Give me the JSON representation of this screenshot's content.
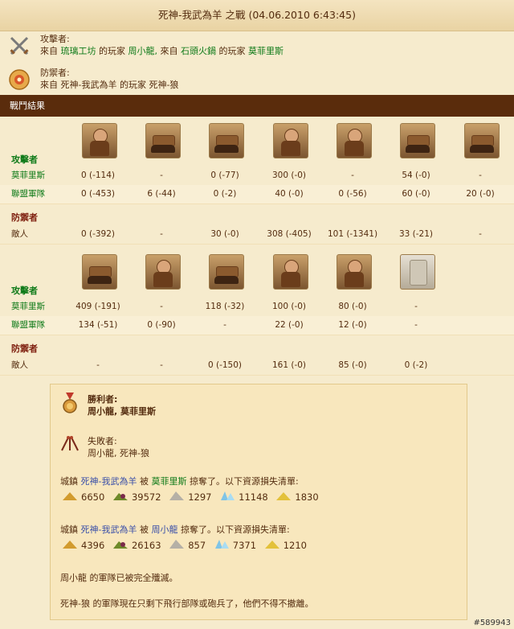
{
  "title": "死神-我武為羊 之戰 (04.06.2010 6:43:45)",
  "attacker": {
    "label": "攻擊者:",
    "from1_pre": "來自",
    "from1_town": "琉璃工坊",
    "from1_mid": "的玩家",
    "from1_player": "周小龍,",
    "from2_pre": "來自",
    "from2_town": "石頭火鍋",
    "from2_mid": "的玩家",
    "from2_player": "莫菲里斯"
  },
  "defender": {
    "label": "防禦者:",
    "text": "來自 死神-我武為羊 的玩家 死神-狼"
  },
  "section_title": "戰鬥結果",
  "battle1": {
    "attackers_label": "攻擊者",
    "defenders_label": "防禦者",
    "rows": [
      {
        "label": "莫菲里斯",
        "cells": [
          "0 (-114)",
          "-",
          "0 (-77)",
          "300 (-0)",
          "-",
          "54 (-0)",
          "-"
        ]
      },
      {
        "label": "聯盟軍隊",
        "cells": [
          "0 (-453)",
          "6 (-44)",
          "0 (-2)",
          "40 (-0)",
          "0 (-56)",
          "60 (-0)",
          "20 (-0)"
        ]
      }
    ],
    "enemy": {
      "label": "敵人",
      "cells": [
        "0 (-392)",
        "-",
        "30 (-0)",
        "308 (-405)",
        "101 (-1341)",
        "33 (-21)",
        "-"
      ]
    }
  },
  "battle2": {
    "attackers_label": "攻擊者",
    "defenders_label": "防禦者",
    "rows": [
      {
        "label": "莫菲里斯",
        "cells": [
          "409 (-191)",
          "-",
          "118 (-32)",
          "100 (-0)",
          "80 (-0)",
          "-"
        ]
      },
      {
        "label": "聯盟軍隊",
        "cells": [
          "134 (-51)",
          "0 (-90)",
          "-",
          "22 (-0)",
          "12 (-0)",
          "-"
        ]
      }
    ],
    "enemy": {
      "label": "敵人",
      "cells": [
        "-",
        "-",
        "0 (-150)",
        "161 (-0)",
        "85 (-0)",
        "0 (-2)"
      ]
    }
  },
  "summary": {
    "winner_label": "勝利者:",
    "winner_names": "周小龍, 莫菲里斯",
    "loser_label": "失敗者:",
    "loser_names": "周小龍, 死神-狼",
    "loot1": {
      "pre": "城鎮",
      "town": "死神-我武為羊",
      "mid": "被",
      "player": "莫菲里斯",
      "post": "掠奪了。以下資源損失清單:"
    },
    "res1": [
      "6650",
      "39572",
      "1297",
      "11148",
      "1830"
    ],
    "loot2": {
      "pre": "城鎮",
      "town": "死神-我武為羊",
      "mid": "被",
      "player": "周小龍",
      "post": "掠奪了。以下資源損失清單:"
    },
    "res2": [
      "4396",
      "26163",
      "857",
      "7371",
      "1210"
    ],
    "line1": "周小龍 的軍隊已被完全殲滅。",
    "line2": "死神-狼 的軍隊現在只剩下飛行部隊或砲兵了，他們不得不撤離。"
  },
  "watermark": "#589943",
  "colors": {
    "bar": "#5a2c0c",
    "green": "#0e7a18",
    "link": "#3a4fa8",
    "panel": "#f8e7bd"
  }
}
